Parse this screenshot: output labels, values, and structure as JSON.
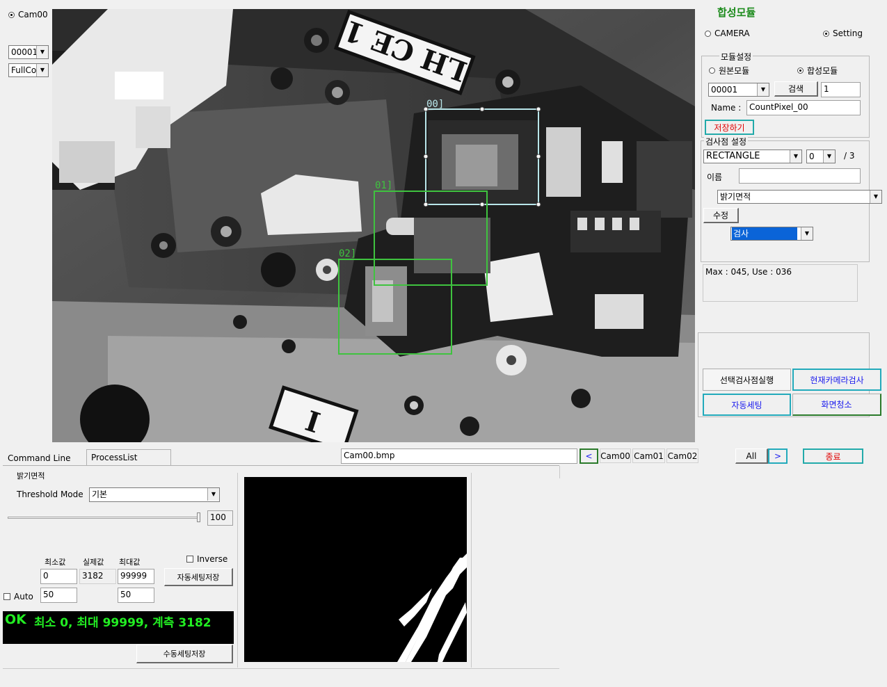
{
  "left": {
    "cam_radio": "Cam00",
    "combo_index": "00001",
    "combo_mode": "FullCo"
  },
  "camera_view": {
    "roi_labels": [
      "00]",
      "01]",
      "02]"
    ]
  },
  "right": {
    "title": "합성모듈",
    "mode_camera": "CAMERA",
    "mode_setting": "Setting",
    "module_group": "모듈설정",
    "radio_original": "원본모듈",
    "radio_composite": "합성모듈",
    "module_index": "00001",
    "search_btn": "검색",
    "count_value": "1",
    "name_label": "Name :",
    "name_value": "CountPixel_00",
    "save_btn": "저장하기",
    "inspect_group": "검사점 설정",
    "shape_combo": "RECTANGLE",
    "point_combo": "0",
    "point_total": "/ 3",
    "name_kr_label": "이름",
    "name_kr_value": "",
    "algo_combo": "밝기면적",
    "edit_btn": "수정",
    "mode_combo": "검사",
    "info_text": "Max : 045, Use : 036",
    "btn_run_selected": "선택검사점실행",
    "btn_run_current": "현재카메라검사",
    "btn_auto": "자동세팅",
    "btn_clear": "화면청소"
  },
  "bottom": {
    "tab_command": "Command Line",
    "tab_process": "ProcessList",
    "file_name": "Cam00.bmp",
    "prev_btn": "<",
    "cam_buttons": [
      "Cam00",
      "Cam01",
      "Cam02"
    ],
    "all_btn": "All",
    "next_btn": ">",
    "exit_btn": "종료"
  },
  "process": {
    "section_label": "밝기면적",
    "threshold_label": "Threshold Mode",
    "threshold_value": "기본",
    "slider_value": "100",
    "min_label": "최소값",
    "actual_label": "실제값",
    "max_label": "최대값",
    "inverse_label": "Inverse",
    "min_value": "0",
    "actual_value": "3182",
    "max_value": "99999",
    "auto_save_btn": "자동세팅저장",
    "auto_label": "Auto",
    "lower_left_value": "50",
    "lower_right_value": "50",
    "result_ok": "OK",
    "result_text": "최소 0, 최대 99999, 계측 3182",
    "manual_save_btn": "수동세팅저장"
  },
  "colors": {
    "roi_cyan": "#b9e6ea",
    "roi_green": "#3fc33f",
    "result_green": "#22ee22",
    "title_green": "#1a8a1a",
    "save_red": "#e00000",
    "btn_blue": "#1a1aee"
  }
}
